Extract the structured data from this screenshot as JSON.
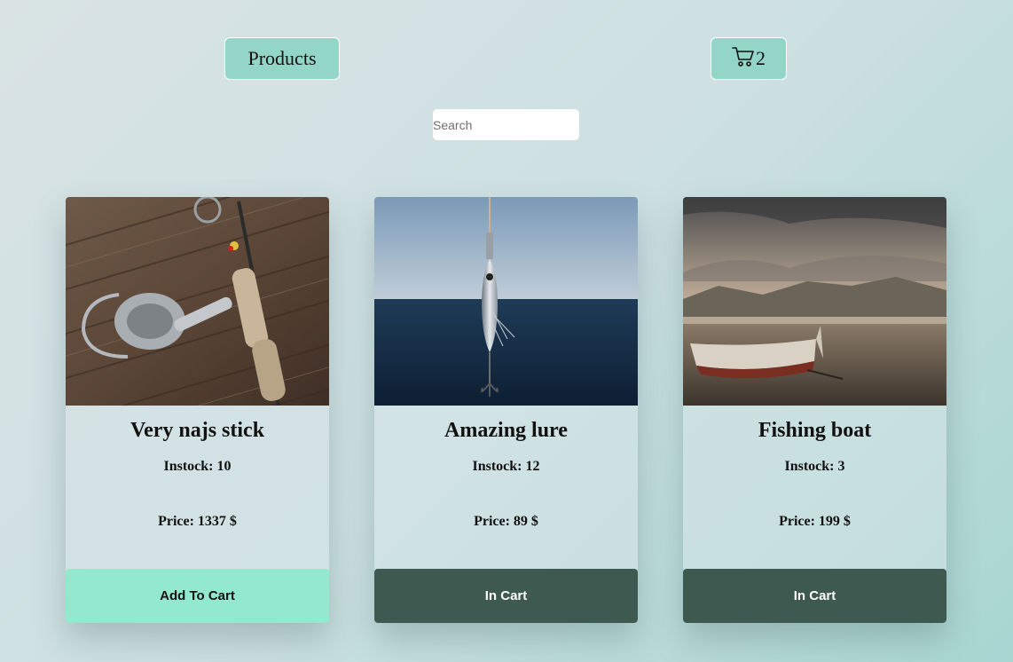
{
  "header": {
    "products_label": "Products",
    "cart_count": "2"
  },
  "search": {
    "placeholder": "Search",
    "value": ""
  },
  "products": [
    {
      "title": "Very najs stick",
      "stock": "Instock: 10",
      "price": "Price: 1337 $",
      "button": "Add To Cart",
      "image": "fishing-rod-reel-on-wooden-deck"
    },
    {
      "title": "Amazing lure",
      "stock": "Instock: 12",
      "price": "Price: 89 $",
      "button": "In Cart",
      "image": "metal-fishing-lure-over-sea"
    },
    {
      "title": "Fishing boat",
      "stock": "Instock: 3",
      "price": "Price: 199 $",
      "button": "In Cart",
      "image": "wooden-boat-on-beach-at-dusk"
    }
  ],
  "colors": {
    "nav_button": "#93d5c6",
    "add_button": "#93e9cd",
    "in_cart_button": "#3d5950"
  },
  "icons": {
    "cart": "cart-icon"
  }
}
